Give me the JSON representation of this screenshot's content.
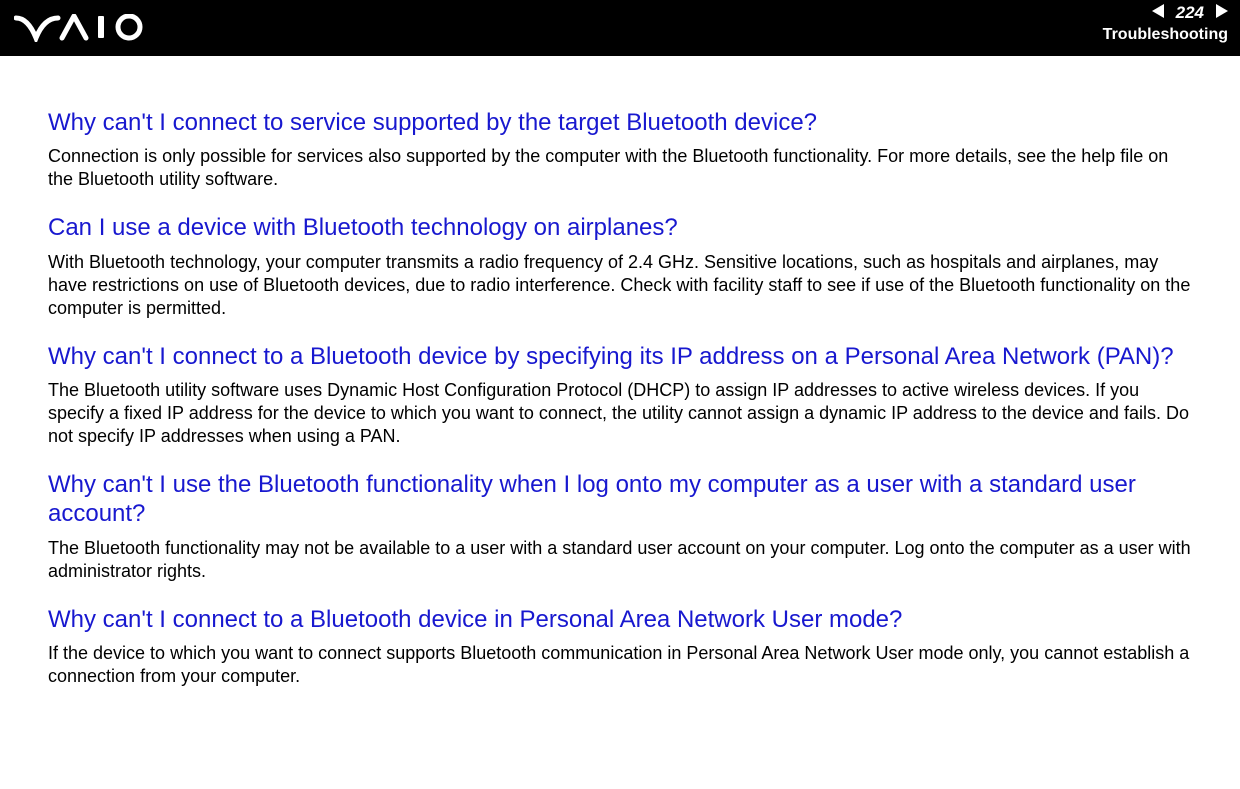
{
  "header": {
    "page_number": "224",
    "section": "Troubleshooting"
  },
  "faqs": [
    {
      "q": "Why can't I connect to service supported by the target Bluetooth device?",
      "a": "Connection is only possible for services also supported by the computer with the Bluetooth functionality. For more details, see the help file on the Bluetooth utility software."
    },
    {
      "q": "Can I use a device with Bluetooth technology on airplanes?",
      "a": "With Bluetooth technology, your computer transmits a radio frequency of 2.4 GHz. Sensitive locations, such as hospitals and airplanes, may have restrictions on use of Bluetooth devices, due to radio interference. Check with facility staff to see if use of the Bluetooth functionality on the computer is permitted."
    },
    {
      "q": "Why can't I connect to a Bluetooth device by specifying its IP address on a Personal Area Network (PAN)?",
      "a": "The Bluetooth utility software uses Dynamic Host Configuration Protocol (DHCP) to assign IP addresses to active wireless devices. If you specify a fixed IP address for the device to which you want to connect, the utility cannot assign a dynamic IP address to the device and fails. Do not specify IP addresses when using a PAN."
    },
    {
      "q": "Why can't I use the Bluetooth functionality when I log onto my computer as a user with a standard user account?",
      "a": "The Bluetooth functionality may not be available to a user with a standard user account on your computer. Log onto the computer as a user with administrator rights."
    },
    {
      "q": "Why can't I connect to a Bluetooth device in Personal Area Network User mode?",
      "a": "If the device to which you want to connect supports Bluetooth communication in Personal Area Network User mode only, you cannot establish a connection from your computer."
    }
  ]
}
